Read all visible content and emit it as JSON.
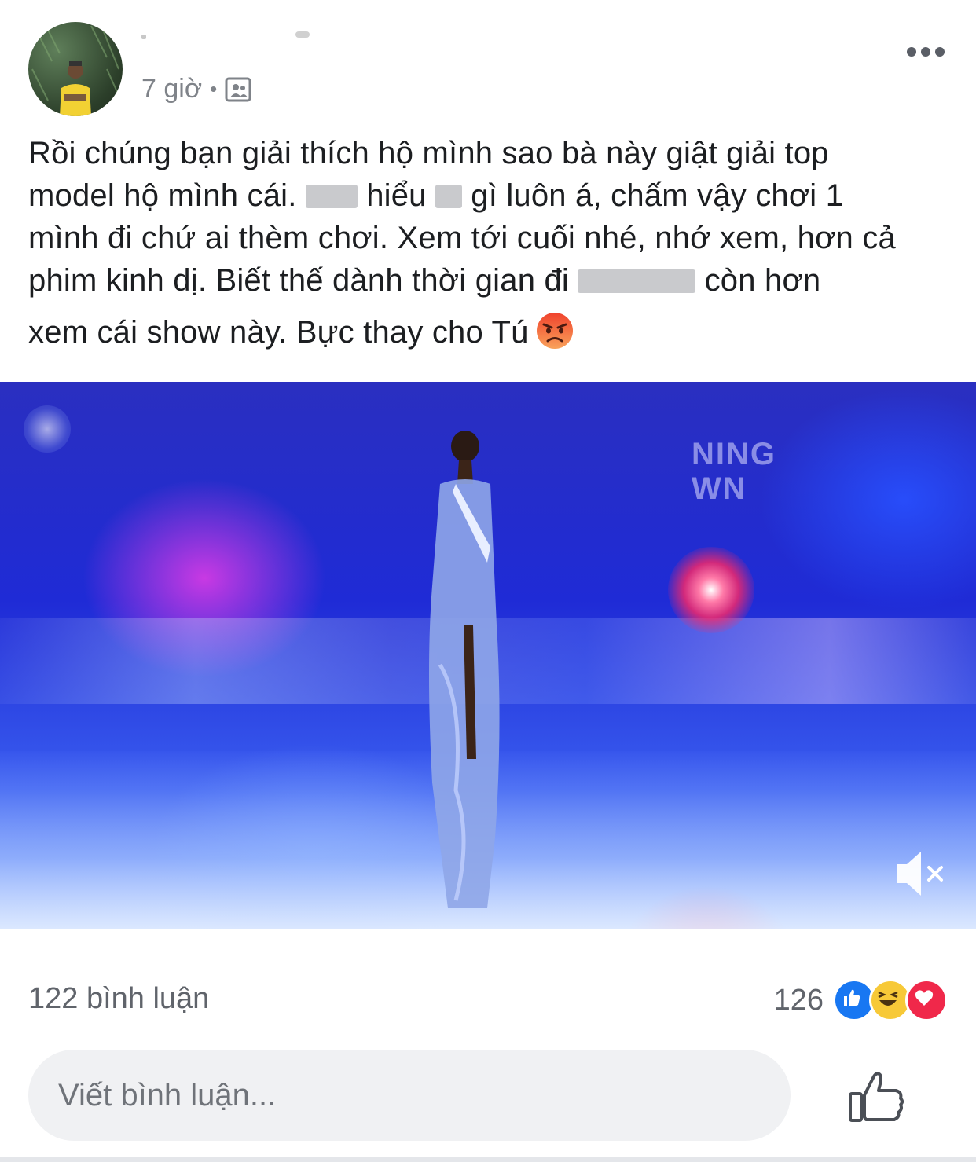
{
  "post": {
    "author": {
      "name": ""
    },
    "timestamp": "7 giờ",
    "separator": "•",
    "audience_icon": "friends-icon",
    "text_lines": [
      "Rồi chúng bạn giải thích hộ mình sao bà này giật giải top",
      [
        "model hộ mình cái. ",
        " hiểu ",
        " gì luôn á, chấm vậy chơi 1"
      ],
      "mình đi chứ ai thèm chơi. Xem tới cuối nhé, nhớ xem, hơn cả",
      [
        "phim kinh dị. Biết thế dành thời gian đi ",
        " còn hơn"
      ],
      "xem cái show này. Bực thay cho Tú"
    ],
    "emoji": "angry-emoji"
  },
  "video": {
    "stage_text_line1": "NING",
    "stage_text_line2": "WN",
    "muted": true,
    "mute_icon": "speaker-muted-icon"
  },
  "stats": {
    "comments": "122 bình luận",
    "reaction_count": "126",
    "reactions": [
      "like",
      "haha",
      "love"
    ]
  },
  "composer": {
    "placeholder": "Viết bình luận...",
    "like_icon": "thumbs-up-icon"
  },
  "colors": {
    "like_blue": "#1877f2",
    "love_red": "#f0284a",
    "haha_yellow": "#f7c938",
    "meta_grey": "#7f8389"
  }
}
